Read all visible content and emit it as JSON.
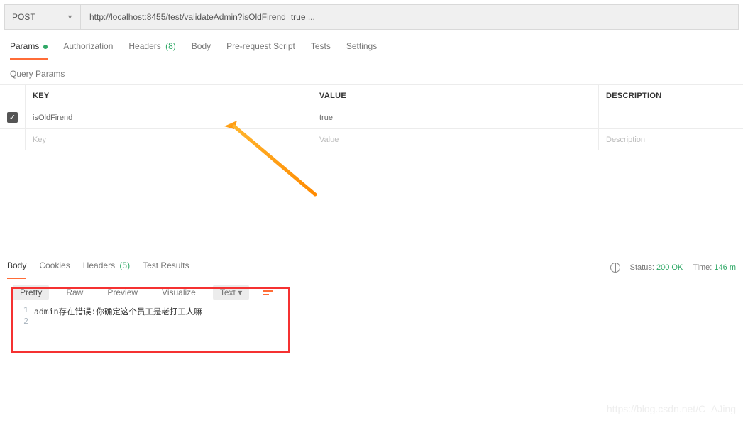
{
  "request": {
    "method": "POST",
    "url": "http://localhost:8455/test/validateAdmin?isOldFirend=true ..."
  },
  "reqTabs": {
    "params": "Params",
    "auth": "Authorization",
    "headers": "Headers",
    "headersCount": "(8)",
    "body": "Body",
    "prereq": "Pre-request Script",
    "tests": "Tests",
    "settings": "Settings"
  },
  "paramsSection": {
    "title": "Query Params",
    "head": {
      "key": "KEY",
      "value": "VALUE",
      "desc": "DESCRIPTION"
    },
    "rows": [
      {
        "key": "isOldFirend",
        "value": "true",
        "desc": ""
      }
    ],
    "placeholders": {
      "key": "Key",
      "value": "Value",
      "desc": "Description"
    }
  },
  "respTabs": {
    "body": "Body",
    "cookies": "Cookies",
    "headers": "Headers",
    "headersCount": "(5)",
    "tests": "Test Results"
  },
  "status": {
    "statusLabel": "Status:",
    "statusValue": "200 OK",
    "timeLabel": "Time:",
    "timeValue": "146 m"
  },
  "viewTabs": {
    "pretty": "Pretty",
    "raw": "Raw",
    "preview": "Preview",
    "visualize": "Visualize",
    "mode": "Text",
    "modeChev": "▾"
  },
  "responseBody": {
    "lines": [
      "admin存在错误:你确定这个员工是老打工人嘛",
      ""
    ],
    "lineNumbers": [
      "1",
      "2"
    ]
  },
  "watermark": "https://blog.csdn.net/C_AJing"
}
